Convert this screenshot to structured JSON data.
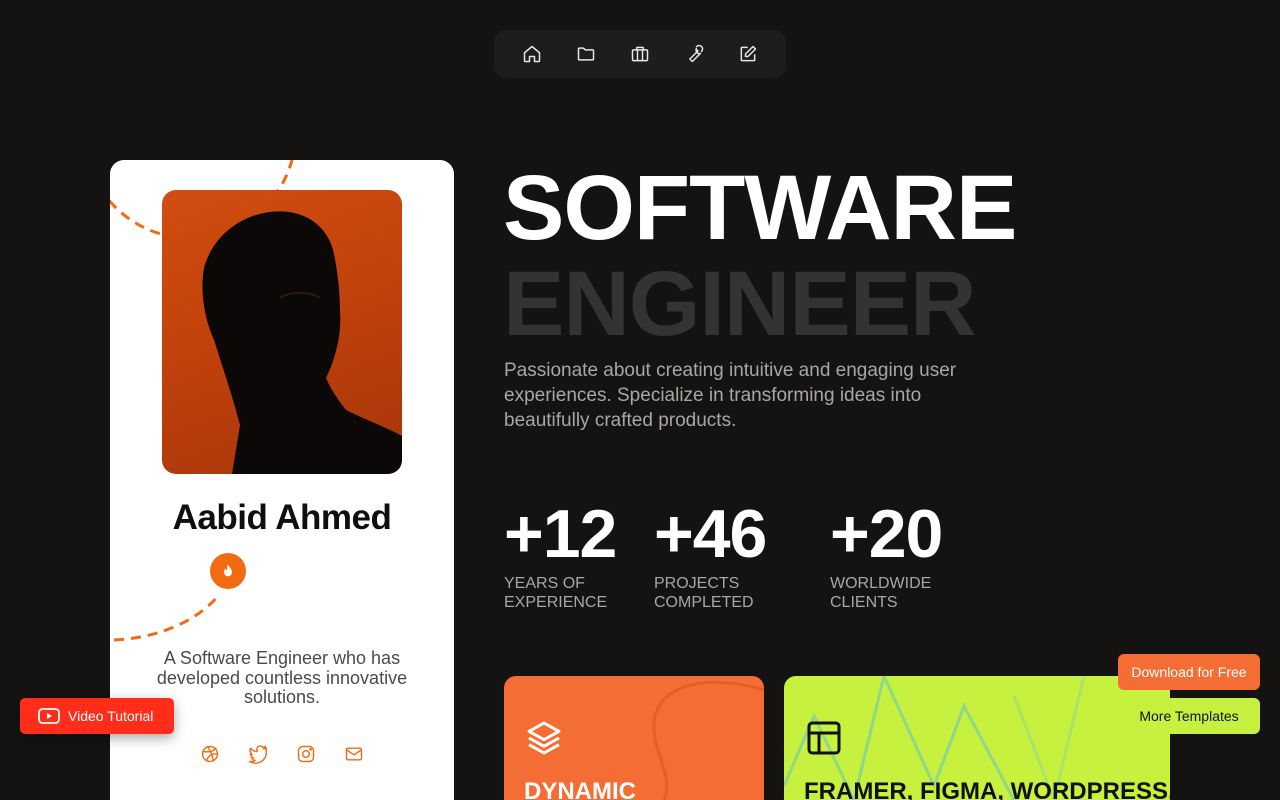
{
  "nav": {
    "items": [
      {
        "icon": "home-icon"
      },
      {
        "icon": "folder-icon"
      },
      {
        "icon": "briefcase-icon"
      },
      {
        "icon": "wrench-icon"
      },
      {
        "icon": "edit-icon"
      }
    ]
  },
  "profile": {
    "name": "Aabid Ahmed",
    "bio": "A Software Engineer who has developed countless innovative solutions.",
    "badge_icon": "flame-icon",
    "socials": [
      {
        "icon": "dribbble-icon"
      },
      {
        "icon": "twitter-icon"
      },
      {
        "icon": "instagram-icon"
      },
      {
        "icon": "mail-icon"
      }
    ]
  },
  "hero": {
    "title_line1": "SOFTWARE",
    "title_line2": "ENGINEER",
    "description": "Passionate about creating intuitive and engaging user experiences. Specialize in transforming ideas into beautifully crafted products."
  },
  "stats": [
    {
      "value": "+12",
      "label_line1": "YEARS OF",
      "label_line2": "EXPERIENCE"
    },
    {
      "value": "+46",
      "label_line1": "PROJECTS",
      "label_line2": "COMPLETED"
    },
    {
      "value": "+20",
      "label_line1": "WORLDWIDE",
      "label_line2": "CLIENTS"
    }
  ],
  "features": [
    {
      "title": "DYNAMIC",
      "icon": "layers-icon",
      "color": "#f36d35"
    },
    {
      "title": "FRAMER, FIGMA, WORDPRESS,",
      "icon": "layout-icon",
      "color": "#c6f13e"
    }
  ],
  "buttons": {
    "video_tutorial": "Video Tutorial",
    "download": "Download for Free",
    "more_templates": "More Templates"
  },
  "colors": {
    "background": "#151312",
    "accent_orange": "#f26b12",
    "accent_lime": "#c6f13e",
    "youtube_red": "#ff2d1a"
  }
}
